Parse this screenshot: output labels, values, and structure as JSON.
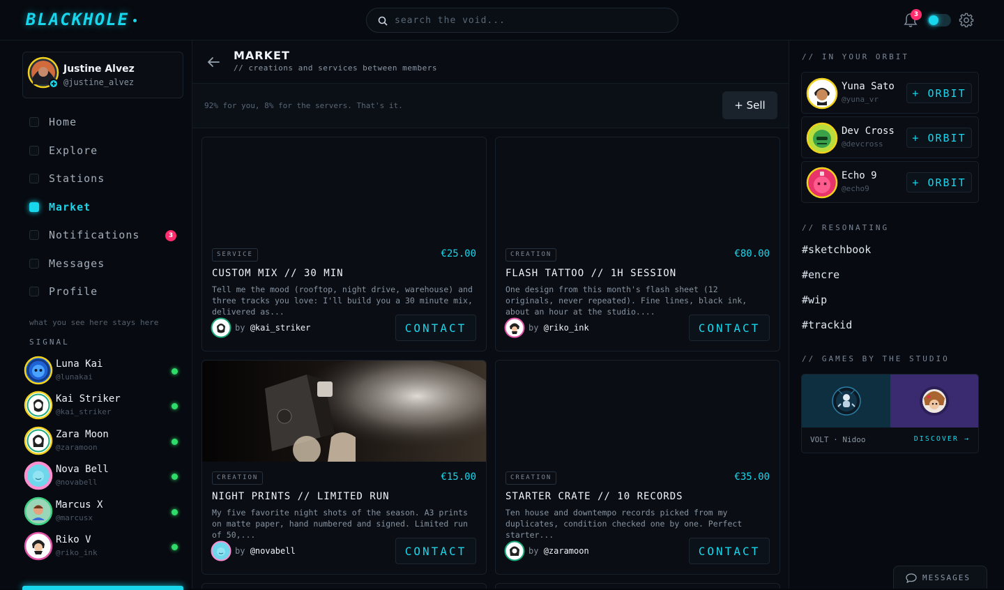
{
  "app": {
    "logo": "BLACKHOLE"
  },
  "search": {
    "placeholder": "search the void..."
  },
  "topbar": {
    "notification_count": "3"
  },
  "profile": {
    "name": "Justine Alvez",
    "handle": "@justine_alvez"
  },
  "nav": [
    {
      "label": "Home"
    },
    {
      "label": "Explore"
    },
    {
      "label": "Stations"
    },
    {
      "label": "Market"
    },
    {
      "label": "Notifications",
      "badge": "3"
    },
    {
      "label": "Messages"
    },
    {
      "label": "Profile"
    }
  ],
  "sidebar": {
    "stays_text": "what you see here stays here",
    "signal_heading": "SIGNAL"
  },
  "signal": [
    {
      "name": "Luna Kai",
      "handle": "@lunakai"
    },
    {
      "name": "Kai Striker",
      "handle": "@kai_striker"
    },
    {
      "name": "Zara Moon",
      "handle": "@zaramoon"
    },
    {
      "name": "Nova Bell",
      "handle": "@novabell"
    },
    {
      "name": "Marcus X",
      "handle": "@marcusx"
    },
    {
      "name": "Riko V",
      "handle": "@riko_ink"
    }
  ],
  "main": {
    "title": "MARKET",
    "subtitle": "// creations and services between members",
    "fee_text": "92% for you, 8% for the servers. That's it.",
    "sell_label": "+ Sell",
    "by_label": "by",
    "contact_label": "CONTACT"
  },
  "listings": [
    {
      "tag": "SERVICE",
      "price": "€25.00",
      "title": "CUSTOM MIX // 30 MIN",
      "desc": "Tell me the mood (rooftop, night drive, warehouse) and three tracks you love: I'll build you a 30 minute mix, delivered as...",
      "seller": "@kai_striker"
    },
    {
      "tag": "CREATION",
      "price": "€80.00",
      "title": "FLASH TATTOO // 1H SESSION",
      "desc": "One design from this month's flash sheet (12 originals, never repeated). Fine lines, black ink, about an hour at the studio....",
      "seller": "@riko_ink"
    },
    {
      "tag": "CREATION",
      "price": "€15.00",
      "title": "NIGHT PRINTS // LIMITED RUN",
      "desc": "My five favorite night shots of the season. A3 prints on matte paper, hand numbered and signed. Limited run of 50,...",
      "seller": "@novabell"
    },
    {
      "tag": "CREATION",
      "price": "€35.00",
      "title": "STARTER CRATE // 10 RECORDS",
      "desc": "Ten house and downtempo records picked from my duplicates, condition checked one by one. Perfect starter...",
      "seller": "@zaramoon"
    }
  ],
  "right": {
    "orbit_heading": "// IN YOUR ORBIT",
    "orbit_button": "+ ORBIT",
    "resonating_heading": "// RESONATING",
    "games_heading": "// GAMES BY THE STUDIO",
    "games_names": "VOLT · Nidoo",
    "discover_label": "DISCOVER →",
    "messages_label": "MESSAGES"
  },
  "orbit": [
    {
      "name": "Yuna Sato",
      "handle": "@yuna_vr"
    },
    {
      "name": "Dev Cross",
      "handle": "@devcross"
    },
    {
      "name": "Echo 9",
      "handle": "@echo9"
    }
  ],
  "hashtags": [
    "#sketchbook",
    "#encre",
    "#wip",
    "#trackid"
  ],
  "colors": {
    "accent": "#18d6ec",
    "badge": "#ff2d6e",
    "online": "#2fdc6a",
    "ring_gold": "#f2d21c"
  }
}
